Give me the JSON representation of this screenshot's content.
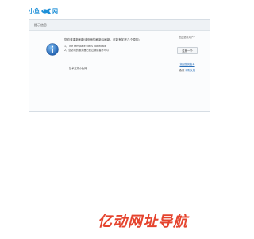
{
  "logo": {
    "text": "小鱼",
    "suffix": "网",
    "colors": {
      "brand": "#1e90d8"
    }
  },
  "panel": {
    "title": "提示信息"
  },
  "message": {
    "title": "您应该重新刷新该页面的刷新后刷新。可能有如下几个原因：",
    "items": [
      "1、The template file is not exists",
      "2、您访问的服务器已经过期或者不可以"
    ],
    "support": "技术支持小鱼网"
  },
  "side": {
    "question": "您还是新用户？",
    "button": "注册一个",
    "link1": "找回您的账号",
    "link2_prefix": "客服",
    "link2_link": "帮助文档"
  },
  "watermark": {
    "text": "亿动网址导航",
    "color": "#e5442e"
  }
}
